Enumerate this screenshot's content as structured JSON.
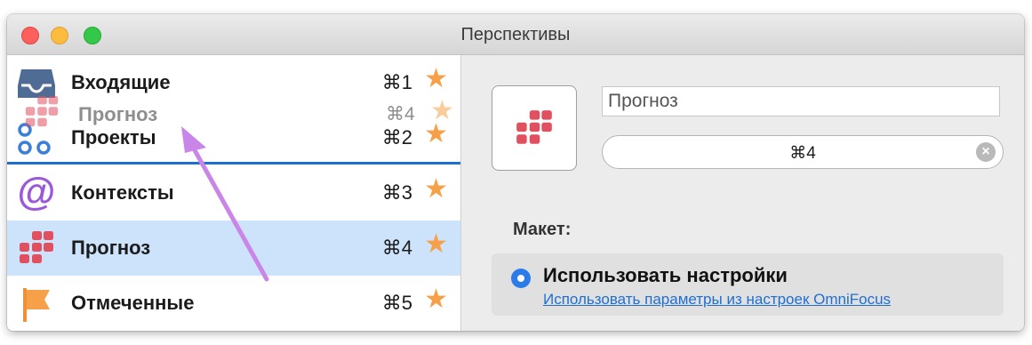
{
  "window": {
    "title": "Перспективы"
  },
  "sidebar": {
    "items": [
      {
        "label": "Входящие",
        "shortcut": "⌘1",
        "icon": "inbox-icon"
      },
      {
        "label": "Проекты",
        "shortcut": "⌘2",
        "icon": "projects-icon"
      },
      {
        "label": "Контексты",
        "shortcut": "⌘3",
        "icon": "at-sign-icon"
      },
      {
        "label": "Прогноз",
        "shortcut": "⌘4",
        "icon": "forecast-grid-icon"
      },
      {
        "label": "Отмеченные",
        "shortcut": "⌘5",
        "icon": "flag-icon"
      }
    ],
    "selected_index": 3,
    "drag_ghost": {
      "label": "Прогноз",
      "shortcut": "⌘4"
    }
  },
  "detail": {
    "name_value": "Прогноз",
    "shortcut_value": "⌘4",
    "layout_label": "Макет:",
    "option_title": "Использовать настройки",
    "option_link": "Использовать параметры из настроек OmniFocus"
  },
  "colors": {
    "selection": "#cde3fb",
    "accent": "#1f6fd2",
    "star": "#f6a14a",
    "forecast_red": "#e0505f",
    "arrow": "#c986e8"
  }
}
